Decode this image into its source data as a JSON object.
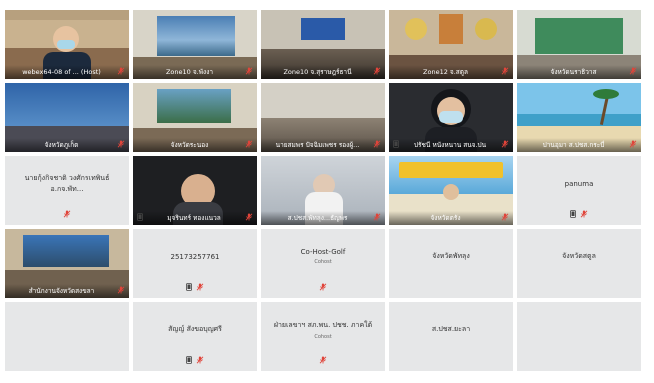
{
  "tiles": [
    [
      {
        "name": "webex64-08 of ... (Host)",
        "kind": "video",
        "scene": "room-person",
        "mic": "muted"
      },
      {
        "name": "Zone10 จ.พังงา",
        "kind": "video",
        "scene": "room-screen",
        "mic": "muted"
      },
      {
        "name": "Zone10 จ.สุราษฎร์ธานี",
        "kind": "video",
        "scene": "meeting-hall",
        "mic": "muted"
      },
      {
        "name": "Zone12 จ.สตูล",
        "kind": "video",
        "scene": "room-seal",
        "mic": "muted"
      },
      {
        "name": "จังหวัดนราธิวาส",
        "kind": "video",
        "scene": "room-green",
        "mic": "muted"
      }
    ],
    [
      {
        "name": "จังหวัดภูเก็ต",
        "kind": "video",
        "scene": "room-blue",
        "mic": "muted"
      },
      {
        "name": "จังหวัดระนอง",
        "kind": "video",
        "scene": "room-screen2",
        "mic": "muted"
      },
      {
        "name": "นายสมพร ปัจฉิมเพชร รองผู้...",
        "kind": "video",
        "scene": "meeting-hall2",
        "mic": "muted"
      },
      {
        "name": "ปรัชนี หนังหนาน สนจ.ปน",
        "kind": "video",
        "scene": "person-mask",
        "mic": "muted",
        "device": true
      },
      {
        "name": "ปานอุมา ส.ปชส.กระบี่",
        "kind": "video",
        "scene": "beach",
        "mic": "muted"
      }
    ],
    [
      {
        "name": "นายกุ้งกิจชาติ วงศักรเทพินธ์ อ.กจ.พัท...",
        "kind": "text",
        "mic": "muted"
      },
      {
        "name": "มุจรินทร์ ทองแนวล",
        "kind": "video",
        "scene": "person-dark",
        "mic": "muted",
        "device": true
      },
      {
        "name": "ส.ปชส.พัทลุง...ธัญพร",
        "kind": "video",
        "scene": "blur",
        "mic": "muted"
      },
      {
        "name": "จังหวัดตรัง",
        "kind": "video",
        "scene": "banner",
        "mic": "muted"
      },
      {
        "name": "panuma",
        "kind": "text",
        "mic": "muted",
        "device": true
      }
    ],
    [
      {
        "name": "สำนักงานจังหวัดสงขลา",
        "kind": "video",
        "scene": "room-screen3",
        "mic": "muted"
      },
      {
        "name": "25173257761",
        "kind": "text",
        "mic": "muted",
        "device": true
      },
      {
        "name": "Co-Host-Golf",
        "sub": "Cohost",
        "kind": "text",
        "mic": "muted"
      },
      {
        "name": "จังหวัดพัทลุง",
        "kind": "text"
      },
      {
        "name": "จังหวัดสตูล",
        "kind": "text"
      }
    ],
    [
      {
        "kind": "empty"
      },
      {
        "name": "สัญญ์ สังขอบุญศรี",
        "kind": "text",
        "mic": "muted",
        "device": true
      },
      {
        "name": "ฝ่ายเลขาฯ สภ.พน. ปชช. ภาคใต้",
        "sub": "Cohost",
        "kind": "text",
        "mic": "muted"
      },
      {
        "name": "ส.ปชส.ยะลา",
        "kind": "text"
      },
      {
        "kind": "empty"
      }
    ]
  ],
  "colors": {
    "mic_muted": "#e0443a",
    "tile_bg": "#e6e7e8"
  }
}
